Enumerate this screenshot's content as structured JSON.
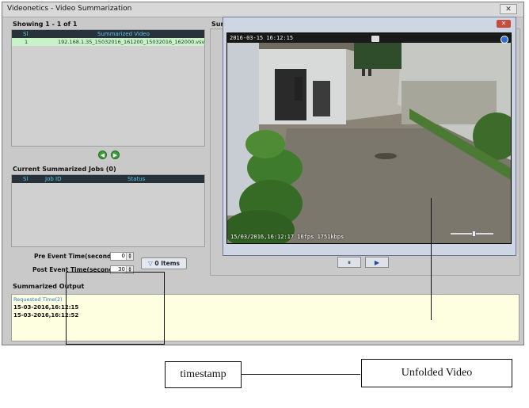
{
  "window": {
    "title": "Videonetics - Video Summarization",
    "close_label": "✕"
  },
  "left": {
    "showing": "Showing 1 - 1 of 1",
    "list_headers": {
      "sl": "Sl",
      "video": "Summarized Video"
    },
    "list_rows": [
      {
        "sl": "1",
        "video": "192.168.1.35_15032016_161200_15032016_162000.vsv"
      }
    ],
    "nav_prev": "◀",
    "nav_next": "▶",
    "jobs_title": "Current Summarized Jobs (0)",
    "jobs_headers": {
      "sl": "Sl",
      "job_id": "Job ID",
      "status": "Status"
    },
    "pre_event_label": "Pre Event Time(seconds)",
    "pre_event_value": "0",
    "post_event_label": "Post Event Time(seconds)",
    "post_event_value": "30",
    "items_button": "0 Items"
  },
  "right": {
    "panel_label": "Summ"
  },
  "video": {
    "close": "✕",
    "osd_top": "2016-03-15 16:12:15",
    "osd_bottom": "15/03/2016,16:12:17 16fps 1751kbps",
    "controls": {
      "pause": "⏸",
      "play": "▶"
    },
    "volume_level": 0.5
  },
  "output": {
    "title": "Summarized Output",
    "column": "Requested Time(2)",
    "rows": [
      "15-03-2016,16:12:15",
      "15-03-2016,16:12:52"
    ]
  },
  "annotations": {
    "timestamp": "timestamp",
    "unfolded": "Unfolded Video"
  }
}
